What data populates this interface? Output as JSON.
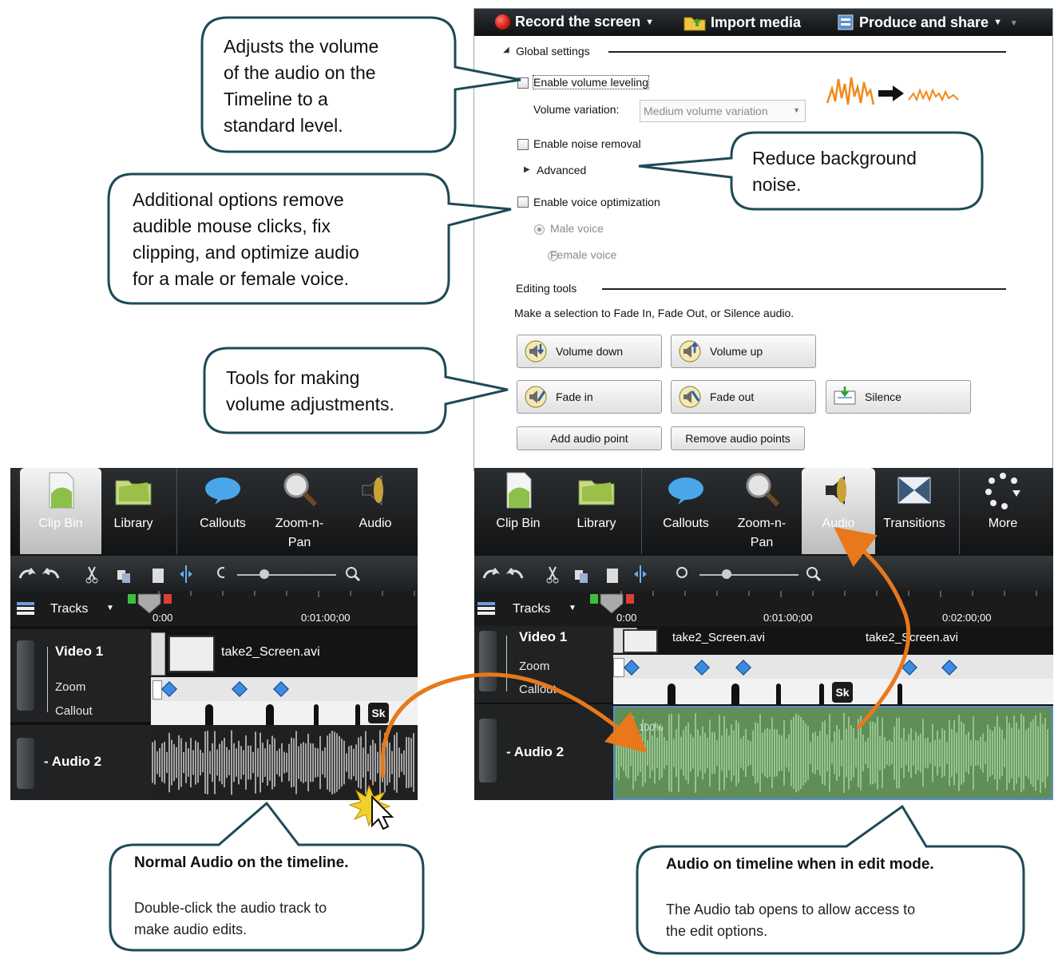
{
  "top_toolbar": {
    "record_label": "Record the screen",
    "import_label": "Import media",
    "produce_label": "Produce and share"
  },
  "audio_panel": {
    "global_settings_title": "Global settings",
    "volume_leveling_label": "Enable volume leveling",
    "volume_variation_label": "Volume variation:",
    "volume_variation_value": "Medium volume variation",
    "noise_removal_label": "Enable noise removal",
    "advanced_label": "Advanced",
    "voice_optimization_label": "Enable voice optimization",
    "male_voice_label": "Male voice",
    "female_voice_label": "Female voice",
    "editing_tools_title": "Editing tools",
    "editing_hint": "Make a selection to Fade In, Fade Out, or Silence audio.",
    "buttons": {
      "volume_down": "Volume down",
      "volume_up": "Volume up",
      "fade_in": "Fade in",
      "fade_out": "Fade out",
      "silence": "Silence",
      "add_audio_point": "Add audio point",
      "remove_audio_points": "Remove audio points"
    }
  },
  "tabs": {
    "clip_bin": "Clip Bin",
    "library": "Library",
    "callouts": "Callouts",
    "zoom_line1": "Zoom-n-",
    "zoom_line2": "Pan",
    "audio": "Audio",
    "transitions": "Transitions",
    "more": "More"
  },
  "timeline": {
    "tracks_label": "Tracks",
    "time_0": "0:00",
    "time_1": "0:01:00;00",
    "time_2": "0:02:00;00",
    "video_track": "Video 1",
    "zoom_track": "Zoom",
    "callout_track": "Callout",
    "audio_track": "Audio 2",
    "clip_name": "take2_Screen.avi",
    "sk_label": "Sk",
    "audio_level_text": "100%"
  },
  "callouts": {
    "volume_leveling": [
      "Adjusts the volume",
      "of the audio on the",
      "Timeline to a",
      "standard level."
    ],
    "noise": [
      "Reduce background",
      "noise."
    ],
    "additional": [
      "Additional options remove",
      "audible mouse clicks, fix",
      "clipping, and optimize audio",
      "for a male or female voice."
    ],
    "tools": [
      "Tools for making",
      "volume adjustments."
    ],
    "normal_title": "Normal Audio on the timeline.",
    "normal_body": [
      "Double-click the audio track to",
      "make audio edits."
    ],
    "edit_title": "Audio on timeline when in edit mode.",
    "edit_body": [
      "The Audio tab opens to allow access to",
      "the edit options."
    ]
  },
  "colors": {
    "arrow_orange": "#e8781a",
    "callout_border": "#1e4a57",
    "diamond_blue": "#3c8be0",
    "waveform_green": "#7fb87a"
  }
}
